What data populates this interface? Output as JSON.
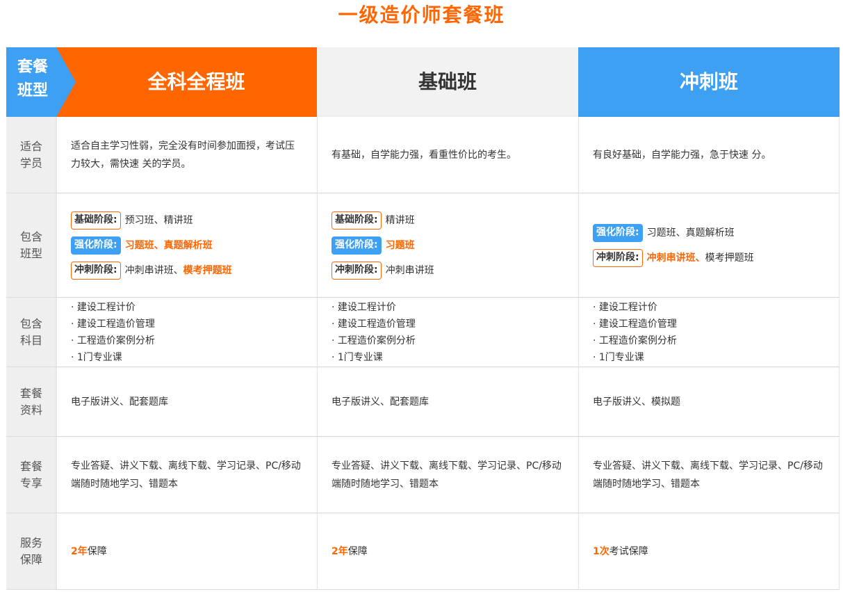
{
  "title": "一级造价师套餐班",
  "header": {
    "label_line1": "套餐",
    "label_line2": "班型",
    "columns": [
      "全科全程班",
      "基础班",
      "冲刺班"
    ]
  },
  "rows": {
    "suitable": {
      "label_line1": "适合",
      "label_line2": "学员",
      "values": [
        "适合自主学习性弱，完全没有时间参加面授，考试压力较大，需快速  关的学员。",
        "有基础，自学能力强，看重性价比的考生。",
        "有良好基础，自学能力强，急于快速  分。"
      ]
    },
    "classes": {
      "label_line1": "包含",
      "label_line2": "班型",
      "col1": [
        {
          "tag": "基础阶段:",
          "text": "预习班、精讲班"
        },
        {
          "tag": "强化阶段:",
          "text": "习题班、真题解析班"
        },
        {
          "tag": "冲刺阶段:",
          "text_plain": "冲刺串讲班、",
          "text_hl": "模考押题班"
        }
      ],
      "col2": [
        {
          "tag": "基础阶段:",
          "text": "精讲班"
        },
        {
          "tag": "强化阶段:",
          "text": "习题班"
        },
        {
          "tag": "冲刺阶段:",
          "text": "冲刺串讲班"
        }
      ],
      "col3": [
        {
          "tag": "强化阶段:",
          "text": "习题班、真题解析班"
        },
        {
          "tag": "冲刺阶段:",
          "text_hl": "冲刺串讲班、",
          "text_plain": "模考押题班"
        }
      ]
    },
    "subjects": {
      "label_line1": "包含",
      "label_line2": "科目",
      "items": [
        "· 建设工程计价",
        "· 建设工程造价管理",
        "· 工程造价案例分析",
        "· 1门专业课"
      ]
    },
    "materials": {
      "label_line1": "套餐",
      "label_line2": "资料",
      "values": [
        "电子版讲义、配套题库",
        "电子版讲义、配套题库",
        "电子版讲义、模拟题"
      ]
    },
    "perks": {
      "label_line1": "套餐",
      "label_line2": "专享",
      "value": "专业答疑、讲义下载、离线下载、学习记录、PC/移动端随时随地学习、错题本"
    },
    "guarantee": {
      "label_line1": "服务",
      "label_line2": "保障",
      "values": [
        {
          "hl": "2年",
          "text": "保障"
        },
        {
          "hl": "2年",
          "text": "保障"
        },
        {
          "hl": "1次",
          "text": "考试保障"
        }
      ]
    }
  },
  "colors": {
    "orange": "#ff6600",
    "blue": "#3da0f2",
    "gray": "#f2f2f2"
  }
}
